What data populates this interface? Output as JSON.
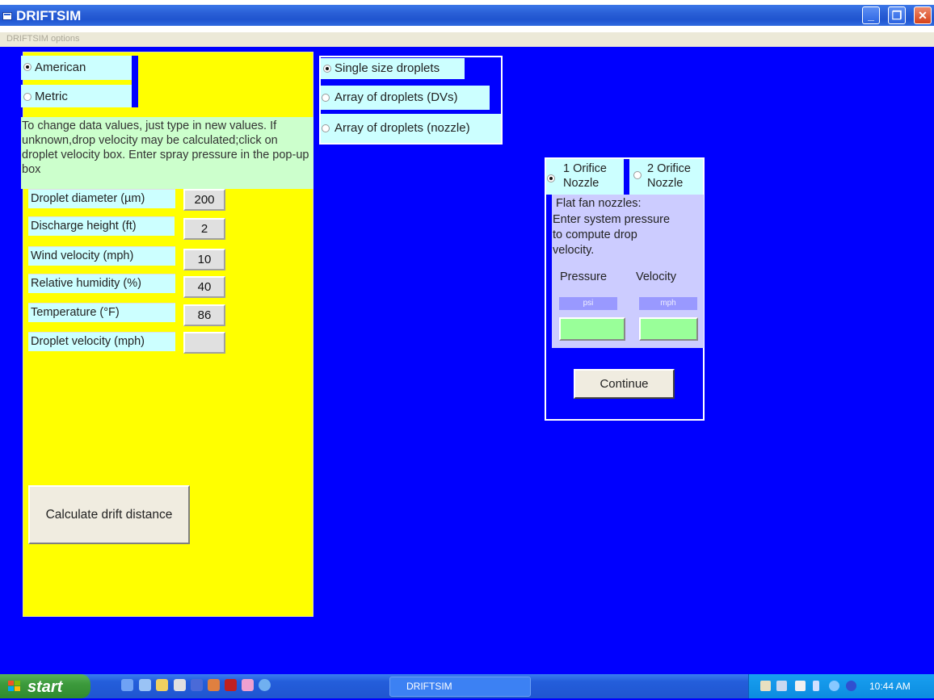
{
  "window": {
    "title": "DRIFTSIM",
    "minimize_label": "_",
    "restore_label": "❐",
    "close_label": "✕"
  },
  "menu": {
    "options_label": "DRIFTSIM options"
  },
  "units": {
    "options": [
      "American",
      "Metric"
    ],
    "selected": "American"
  },
  "droplet_mode": {
    "options": [
      "Single size droplets",
      "Array of droplets (DVs)",
      "Array of droplets (nozzle)"
    ],
    "selected": "Single size droplets"
  },
  "instructions": "To change data values, just type in new values. If unknown,drop velocity may be calculated;click on droplet velocity box. Enter spray pressure in the pop-up box",
  "fields": [
    {
      "label": "Droplet diameter (µm)",
      "value": "200"
    },
    {
      "label": "Discharge height (ft)",
      "value": "2"
    },
    {
      "label": "Wind velocity (mph)",
      "value": "10"
    },
    {
      "label": "Relative humidity (%)",
      "value": "40"
    },
    {
      "label": "Temperature (°F)",
      "value": "86"
    },
    {
      "label": "Droplet velocity (mph)",
      "value": ""
    }
  ],
  "calculate_button": "Calculate drift distance",
  "nozzle_dialog": {
    "orifice_options": [
      "1 Orifice Nozzle",
      "2 Orifice Nozzle"
    ],
    "orifice_1_line1": "1 Orifice",
    "orifice_1_line2": "Nozzle",
    "orifice_2_line1": "2 Orifice",
    "orifice_2_line2": "Nozzle",
    "selected": "1 Orifice Nozzle",
    "text_line1": "Flat fan nozzles:",
    "text_line2": "Enter system pressure",
    "text_line3": "to compute drop",
    "text_line4": "velocity.",
    "pressure_label": "Pressure",
    "velocity_label": "Velocity",
    "pressure_unit": "psi",
    "velocity_unit": "mph",
    "pressure_value": "",
    "velocity_value": "",
    "continue_button": "Continue"
  },
  "taskbar": {
    "start_label": "start",
    "active_task": "DRIFTSIM",
    "clock": "10:44 AM"
  },
  "colors": {
    "background": "#0000ff",
    "panel_yellow": "#ffff00",
    "label_cyan": "#ccffff",
    "info_green": "#ccffcc",
    "dialog_lavender": "#ccccff",
    "input_green": "#99ff99"
  }
}
